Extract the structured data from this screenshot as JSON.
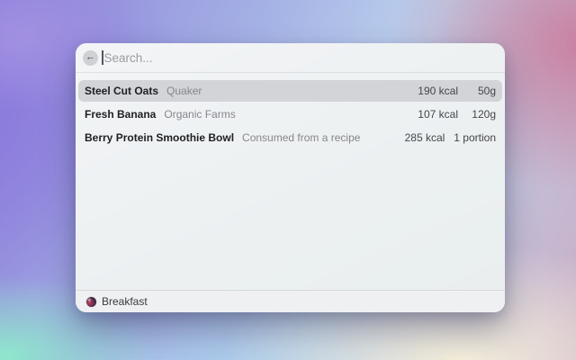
{
  "search": {
    "placeholder": "Search...",
    "back_icon": "←"
  },
  "items": [
    {
      "name": "Steel Cut Oats",
      "source": "Quaker",
      "calories": "190 kcal",
      "quantity": "50g",
      "selected": true
    },
    {
      "name": "Fresh Banana",
      "source": "Organic Farms",
      "calories": "107 kcal",
      "quantity": "120g",
      "selected": false
    },
    {
      "name": "Berry Protein Smoothie Bowl",
      "source": "Consumed from a recipe",
      "calories": "285 kcal",
      "quantity": "1 portion",
      "selected": false
    }
  ],
  "footer": {
    "label": "Breakfast"
  },
  "colors": {
    "selected_row": "#d2d4d8",
    "window_surface": "#eff1f3",
    "gradient_purple": "#8a77dd",
    "gradient_mint": "#8fe7cd",
    "gradient_blue": "#a9cdec",
    "gradient_pink": "#c9809f",
    "gradient_cream": "#f5efdb"
  }
}
